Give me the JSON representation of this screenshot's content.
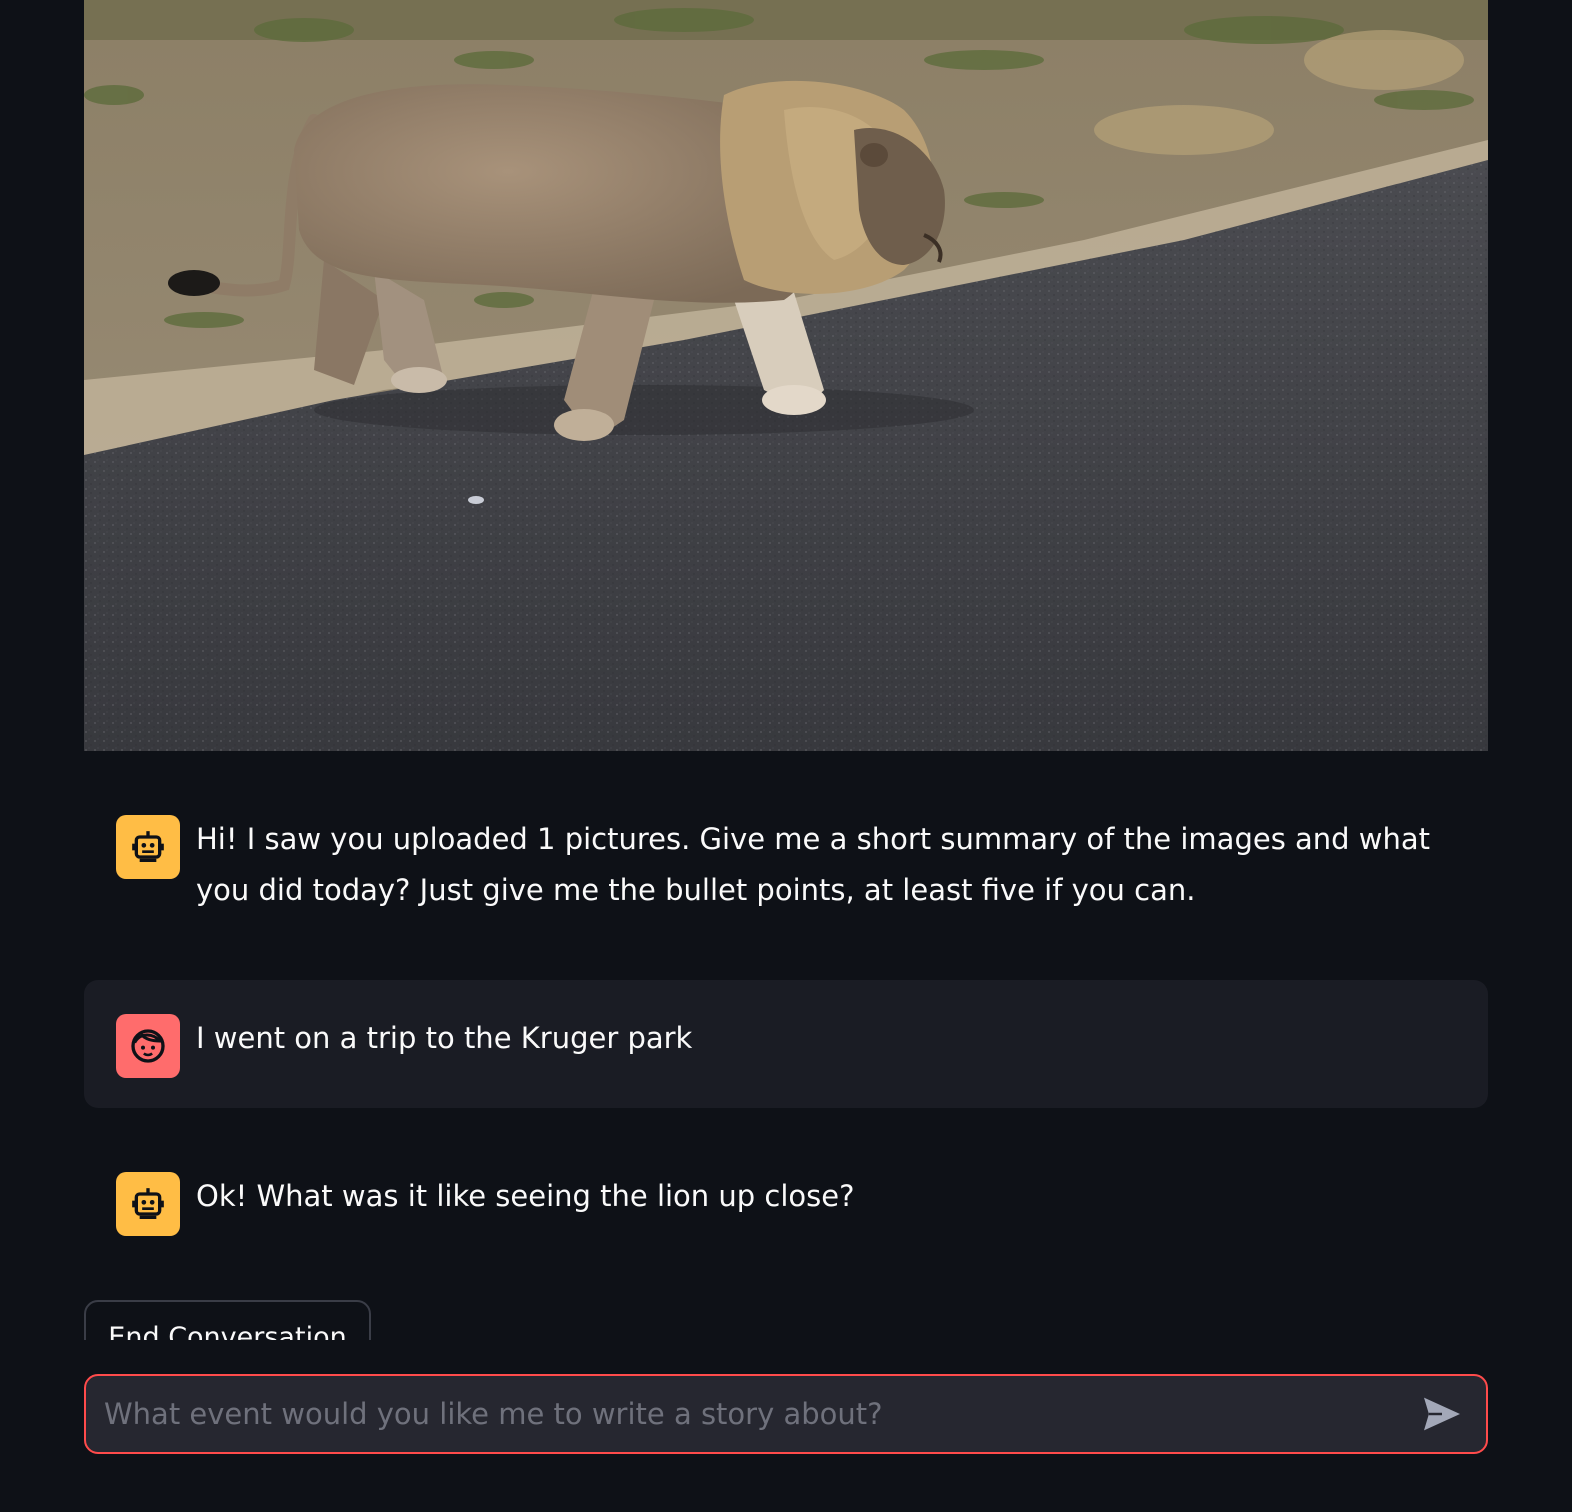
{
  "photo": {
    "subject": "lion walking on road",
    "icon": "uploaded-image"
  },
  "messages": [
    {
      "role": "assistant",
      "avatar_icon": "robot-icon",
      "text": "Hi! I saw you uploaded 1 pictures. Give me a short summary of the images and what you did today? Just give me the bullet points, at least five if you can."
    },
    {
      "role": "user",
      "avatar_icon": "face-icon",
      "text": "I went on a trip to the Kruger park"
    },
    {
      "role": "assistant",
      "avatar_icon": "robot-icon",
      "text": "Ok! What was it like seeing the lion up close?"
    }
  ],
  "end_button": {
    "label": "End Conversation"
  },
  "chat_input": {
    "placeholder": "What event would you like me to write a story about?",
    "value": "",
    "send_icon": "send-icon"
  },
  "colors": {
    "background": "#0e1117",
    "user_message_bg": "#1a1c24",
    "bot_avatar": "#ffbd45",
    "user_avatar": "#ff6c6c",
    "input_border_focus": "#ff4b4b",
    "input_bg": "#262730"
  }
}
